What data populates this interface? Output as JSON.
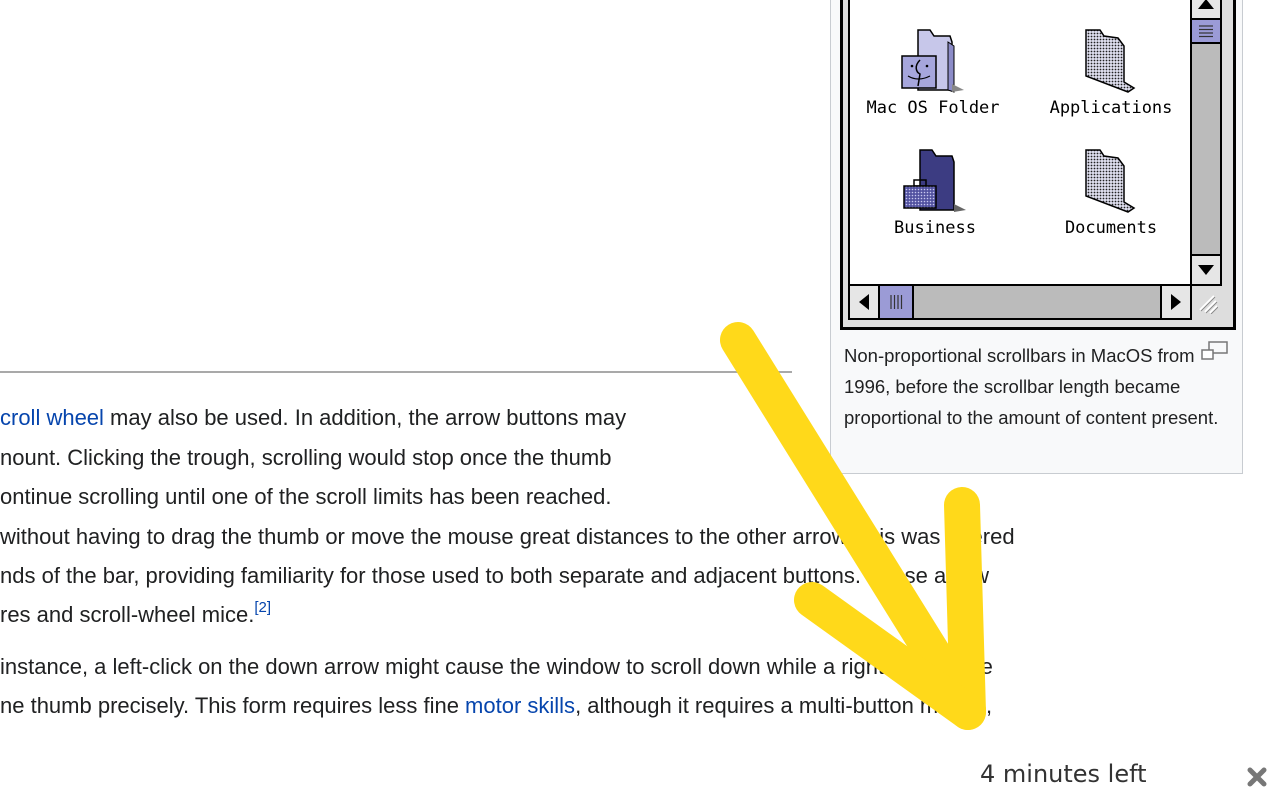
{
  "article": {
    "lines": [
      {
        "pre": "",
        "link": "croll wheel",
        "post": " may also be used. In addition, the arrow buttons may"
      },
      {
        "pre": "nount. Clicking the trough, scrolling would stop once the thumb",
        "link": "",
        "post": ""
      },
      {
        "pre": "ontinue scrolling until one of the scroll limits has been reached.",
        "link": "",
        "post": ""
      },
      {
        "pre": "without having to drag the thumb or move the mouse great distances to the other arrow (this was offered",
        "link": "",
        "post": ""
      },
      {
        "pre": "nds of the bar, providing familiarity for those used to both separate and adjacent buttons. These arrow",
        "link": "",
        "post": ""
      },
      {
        "pre": "res and scroll-wheel mice.",
        "link": "",
        "post": "",
        "ref": "[2]"
      },
      {
        "pre": " instance, a left-click on the down arrow might cause the window to scroll down while a right click in the",
        "link": "",
        "post": ""
      },
      {
        "pre": "ne thumb precisely. This form requires less fine ",
        "link": "motor skills",
        "post": ", although it requires a multi-button mouse,"
      }
    ]
  },
  "figure": {
    "icons": [
      {
        "label": "Mac OS Folder",
        "icon": "system-folder-icon"
      },
      {
        "label": "Applications",
        "icon": "folder-icon"
      },
      {
        "label": "Business",
        "icon": "business-folder-icon"
      },
      {
        "label": "Documents",
        "icon": "folder-icon"
      }
    ],
    "caption": "Non-proportional scrollbars in MacOS from 1996, before the scrollbar length became proportional to the amount of content present.",
    "colors": {
      "scroll_thumb": "#9b9bd6",
      "scroll_track": "#bbbbbb",
      "business_folder": "#3c3c82"
    }
  },
  "overlay": {
    "arrow_color": "#ffd91a",
    "arrow_semantic": "annotation-arrow-pointing-down-right"
  },
  "status": {
    "time_left": "4 minutes left",
    "close_icon": "close-icon"
  }
}
